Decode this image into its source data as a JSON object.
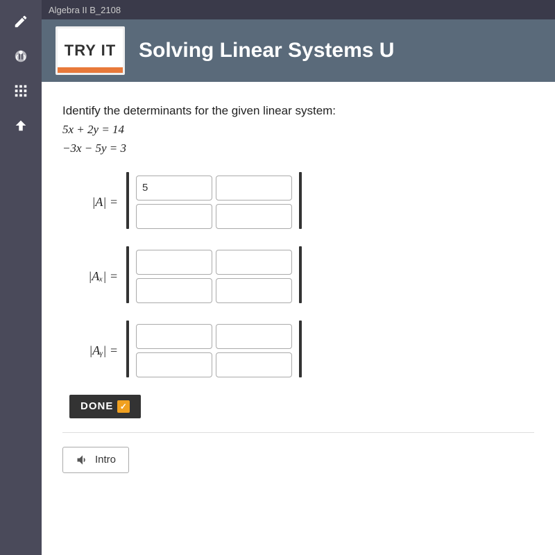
{
  "topbar": {
    "title": "Algebra II B_2108"
  },
  "sidebar": {
    "items": [
      {
        "name": "pencil-icon",
        "label": "Edit"
      },
      {
        "name": "headphones-icon",
        "label": "Audio"
      },
      {
        "name": "grid-icon",
        "label": "Menu"
      },
      {
        "name": "up-arrow-icon",
        "label": "Up"
      }
    ]
  },
  "header": {
    "badge_text": "TRY IT",
    "title": "Solving Linear Systems U"
  },
  "content": {
    "instruction": "Identify the determinants for the given linear system:",
    "equations": [
      "5x + 2y = 14",
      "−3x − 5y = 3"
    ],
    "matrix_A": {
      "label": "|A| =",
      "cells": [
        {
          "id": "a11",
          "value": "5",
          "placeholder": ""
        },
        {
          "id": "a12",
          "value": "",
          "placeholder": ""
        },
        {
          "id": "a21",
          "value": "",
          "placeholder": ""
        },
        {
          "id": "a22",
          "value": "",
          "placeholder": ""
        }
      ]
    },
    "matrix_Ax": {
      "label": "|Aₓ| =",
      "cells": [
        {
          "id": "ax11",
          "value": "",
          "placeholder": ""
        },
        {
          "id": "ax12",
          "value": "",
          "placeholder": ""
        },
        {
          "id": "ax21",
          "value": "",
          "placeholder": ""
        },
        {
          "id": "ax22",
          "value": "",
          "placeholder": ""
        }
      ]
    },
    "matrix_Ay": {
      "label": "|Aᵧ| =",
      "cells": [
        {
          "id": "ay11",
          "value": "",
          "placeholder": ""
        },
        {
          "id": "ay12",
          "value": "",
          "placeholder": ""
        },
        {
          "id": "ay21",
          "value": "",
          "placeholder": ""
        },
        {
          "id": "ay22",
          "value": "",
          "placeholder": ""
        }
      ]
    },
    "done_button": "DONE",
    "intro_button": "Intro"
  }
}
